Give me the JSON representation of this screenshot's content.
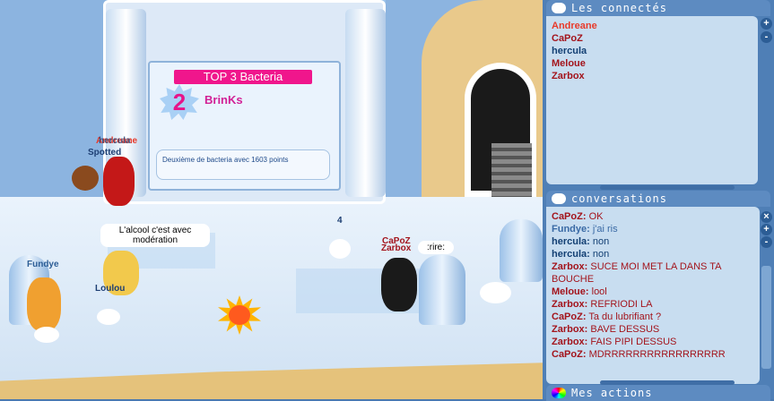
{
  "game": {
    "leaderboard": {
      "title": "TOP 3 Bacteria",
      "rank": "2",
      "player": "BrinKs",
      "caption": "Deuxième de bacteria avec 1603 points"
    },
    "bubbles": [
      {
        "text": "L'alcool c'est avec modération"
      },
      {
        "text": ":rire:"
      }
    ],
    "names": [
      {
        "text": "Andreane",
        "color": "#e83a2a"
      },
      {
        "text": "hercula",
        "color": "#1e3f73"
      },
      {
        "text": "Spotted",
        "color": "#1e3f73"
      },
      {
        "text": "Fundye",
        "color": "#2c5d95"
      },
      {
        "text": "Loulou",
        "color": "#1e3f73"
      },
      {
        "text": "CaPoZ",
        "color": "#a3141c"
      },
      {
        "text": "Zarbox",
        "color": "#a3141c"
      },
      {
        "text": "4",
        "color": "#1e3f73"
      }
    ]
  },
  "panel": {
    "connected": {
      "title": "Les connectés",
      "users": [
        {
          "name": "Andreane",
          "color": "#e83a2a"
        },
        {
          "name": "CaPoZ",
          "color": "#a3141c"
        },
        {
          "name": "hercula",
          "color": "#123f73"
        },
        {
          "name": "Meloue",
          "color": "#a3141c"
        },
        {
          "name": "Zarbox",
          "color": "#a3141c"
        }
      ]
    },
    "conversations": {
      "title": "conversations",
      "messages": [
        {
          "user": "CaPoZ:",
          "text": "OK",
          "color": "#a3141c"
        },
        {
          "user": "Fundye:",
          "text": "j'ai ris",
          "color": "#3a6aa5"
        },
        {
          "user": "hercula:",
          "text": "non",
          "color": "#123f73"
        },
        {
          "user": "hercula:",
          "text": "non",
          "color": "#123f73"
        },
        {
          "user": "Zarbox:",
          "text": "SUCE MOI MET LA DANS TA",
          "color": "#a3141c"
        },
        {
          "user": "",
          "text": "BOUCHE",
          "color": "#a3141c"
        },
        {
          "user": "Meloue:",
          "text": "lool",
          "color": "#a3141c"
        },
        {
          "user": "Zarbox:",
          "text": "REFRIODI LA",
          "color": "#a3141c"
        },
        {
          "user": "CaPoZ:",
          "text": "Ta du lubrifiant ?",
          "color": "#a3141c"
        },
        {
          "user": "Zarbox:",
          "text": "BAVE DESSUS",
          "color": "#a3141c"
        },
        {
          "user": "Zarbox:",
          "text": "FAIS PIPI DESSUS",
          "color": "#a3141c"
        },
        {
          "user": "CaPoZ:",
          "text": "MDRRRRRRRRRRRRRRRRR",
          "color": "#a3141c"
        }
      ]
    },
    "actions": {
      "title": "Mes actions"
    },
    "buttons": {
      "plus": "+",
      "minus": "-",
      "close": "×"
    }
  }
}
